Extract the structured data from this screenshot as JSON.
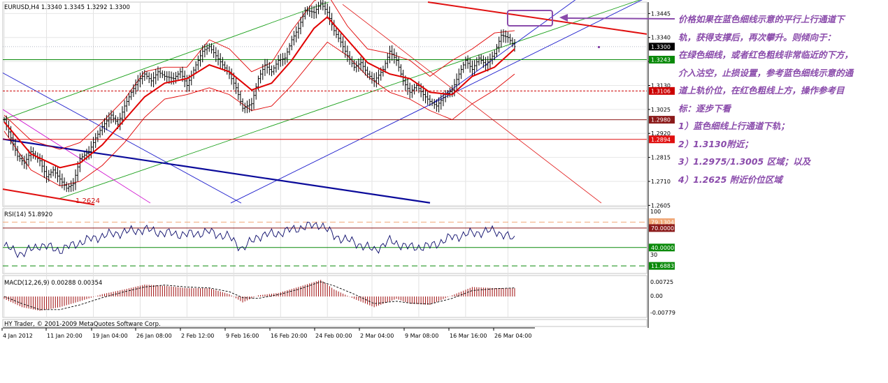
{
  "chart_data": [
    {
      "type": "candlestick",
      "title": "EURUSD,H4  1.3340 1.3345 1.3292 1.3300",
      "ylim": [
        1.26,
        1.3495
      ],
      "y_ticks": [
        "1.3445",
        "1.3340",
        "1.3235",
        "1.3130",
        "1.3025",
        "1.2920",
        "1.2815",
        "1.2710",
        "1.2605"
      ],
      "price_labels": [
        {
          "value": 1.33,
          "label": "1.3300",
          "color": "#000000"
        },
        {
          "value": 1.3243,
          "label": "1.3243",
          "color": "#0a8a0a"
        },
        {
          "value": 1.3106,
          "label": "1.3106",
          "color": "#cc0000"
        },
        {
          "value": 1.298,
          "label": "1.2980",
          "color": "#8b1a1a"
        },
        {
          "value": 1.2894,
          "label": "1.2894",
          "color": "#e01010"
        }
      ],
      "annotation": "1.2624",
      "x_ticks": [
        "4 Jan 2012",
        "11 Jan 20:00",
        "19 Jan 04:00",
        "26 Jan 08:00",
        "2 Feb 12:00",
        "9 Feb 16:00",
        "16 Feb 20:00",
        "24 Feb 00:00",
        "2 Mar 04:00",
        "9 Mar 08:00",
        "16 Mar 16:00",
        "26 Mar 04:00"
      ],
      "close_path": [
        [
          0,
          1.298
        ],
        [
          3,
          1.29
        ],
        [
          6,
          1.282
        ],
        [
          9,
          1.279
        ],
        [
          12,
          1.284
        ],
        [
          16,
          1.28
        ],
        [
          19,
          1.273
        ],
        [
          22,
          1.276
        ],
        [
          25,
          1.272
        ],
        [
          28,
          1.268
        ],
        [
          31,
          1.27
        ],
        [
          34,
          1.281
        ],
        [
          38,
          1.284
        ],
        [
          41,
          1.29
        ],
        [
          44,
          1.295
        ],
        [
          48,
          1.3
        ],
        [
          51,
          1.296
        ],
        [
          54,
          1.304
        ],
        [
          57,
          1.31
        ],
        [
          60,
          1.315
        ],
        [
          63,
          1.318
        ],
        [
          66,
          1.315
        ],
        [
          69,
          1.319
        ],
        [
          72,
          1.317
        ],
        [
          76,
          1.316
        ],
        [
          79,
          1.319
        ],
        [
          82,
          1.313
        ],
        [
          86,
          1.322
        ],
        [
          89,
          1.328
        ],
        [
          92,
          1.33
        ],
        [
          95,
          1.326
        ],
        [
          98,
          1.322
        ],
        [
          101,
          1.318
        ],
        [
          104,
          1.312
        ],
        [
          107,
          1.303
        ],
        [
          111,
          1.305
        ],
        [
          114,
          1.316
        ],
        [
          117,
          1.322
        ],
        [
          120,
          1.319
        ],
        [
          123,
          1.324
        ],
        [
          126,
          1.325
        ],
        [
          129,
          1.333
        ],
        [
          132,
          1.338
        ],
        [
          135,
          1.346
        ],
        [
          139,
          1.345
        ],
        [
          142,
          1.349
        ],
        [
          145,
          1.345
        ],
        [
          148,
          1.337
        ],
        [
          151,
          1.332
        ],
        [
          154,
          1.326
        ],
        [
          157,
          1.321
        ],
        [
          160,
          1.323
        ],
        [
          163,
          1.318
        ],
        [
          166,
          1.315
        ],
        [
          170,
          1.32
        ],
        [
          173,
          1.328
        ],
        [
          176,
          1.324
        ],
        [
          179,
          1.315
        ],
        [
          182,
          1.31
        ],
        [
          185,
          1.313
        ],
        [
          188,
          1.309
        ],
        [
          191,
          1.306
        ],
        [
          194,
          1.304
        ],
        [
          198,
          1.309
        ],
        [
          201,
          1.311
        ],
        [
          204,
          1.318
        ],
        [
          207,
          1.324
        ],
        [
          210,
          1.32
        ],
        [
          213,
          1.325
        ],
        [
          216,
          1.322
        ],
        [
          220,
          1.327
        ],
        [
          223,
          1.335
        ],
        [
          226,
          1.334
        ],
        [
          229,
          1.33
        ]
      ],
      "moving_average": [
        [
          0,
          1.297
        ],
        [
          12,
          1.283
        ],
        [
          25,
          1.277
        ],
        [
          34,
          1.279
        ],
        [
          44,
          1.287
        ],
        [
          54,
          1.298
        ],
        [
          63,
          1.308
        ],
        [
          72,
          1.314
        ],
        [
          82,
          1.316
        ],
        [
          92,
          1.322
        ],
        [
          101,
          1.319
        ],
        [
          111,
          1.311
        ],
        [
          120,
          1.314
        ],
        [
          129,
          1.324
        ],
        [
          139,
          1.338
        ],
        [
          145,
          1.343
        ],
        [
          154,
          1.333
        ],
        [
          163,
          1.323
        ],
        [
          173,
          1.318
        ],
        [
          182,
          1.316
        ],
        [
          191,
          1.31
        ],
        [
          201,
          1.309
        ],
        [
          210,
          1.317
        ],
        [
          220,
          1.321
        ],
        [
          229,
          1.329
        ]
      ],
      "bollinger_upper": [
        [
          0,
          1.3
        ],
        [
          12,
          1.289
        ],
        [
          25,
          1.285
        ],
        [
          34,
          1.288
        ],
        [
          44,
          1.297
        ],
        [
          54,
          1.307
        ],
        [
          63,
          1.319
        ],
        [
          72,
          1.321
        ],
        [
          82,
          1.321
        ],
        [
          92,
          1.333
        ],
        [
          101,
          1.329
        ],
        [
          111,
          1.319
        ],
        [
          120,
          1.323
        ],
        [
          129,
          1.337
        ],
        [
          139,
          1.35
        ],
        [
          145,
          1.353
        ],
        [
          154,
          1.339
        ],
        [
          163,
          1.329
        ],
        [
          173,
          1.327
        ],
        [
          182,
          1.324
        ],
        [
          191,
          1.317
        ],
        [
          201,
          1.324
        ],
        [
          210,
          1.329
        ],
        [
          220,
          1.336
        ],
        [
          229,
          1.337
        ]
      ],
      "bollinger_lower": [
        [
          0,
          1.293
        ],
        [
          12,
          1.276
        ],
        [
          25,
          1.269
        ],
        [
          34,
          1.271
        ],
        [
          44,
          1.278
        ],
        [
          54,
          1.288
        ],
        [
          63,
          1.299
        ],
        [
          72,
          1.307
        ],
        [
          82,
          1.309
        ],
        [
          92,
          1.312
        ],
        [
          101,
          1.309
        ],
        [
          111,
          1.302
        ],
        [
          120,
          1.304
        ],
        [
          129,
          1.313
        ],
        [
          139,
          1.325
        ],
        [
          145,
          1.332
        ],
        [
          154,
          1.326
        ],
        [
          163,
          1.317
        ],
        [
          173,
          1.31
        ],
        [
          182,
          1.307
        ],
        [
          191,
          1.302
        ],
        [
          201,
          1.298
        ],
        [
          210,
          1.305
        ],
        [
          220,
          1.311
        ],
        [
          229,
          1.318
        ]
      ]
    },
    {
      "type": "line",
      "title": "RSI(14) 51.8920",
      "ylim": [
        0,
        100
      ],
      "y_ticks": [
        "100",
        "30"
      ],
      "levels": [
        {
          "value": 79.1304,
          "label": "79.1304",
          "color": "#f0a878"
        },
        {
          "value": 70,
          "label": "70.0000",
          "color": "#8b1a1a"
        },
        {
          "value": 40,
          "label": "40.0000",
          "color": "#0a8a0a"
        },
        {
          "value": 11.6883,
          "label": "11.6883",
          "color": "#0a8a0a"
        }
      ],
      "values": [
        [
          0,
          42
        ],
        [
          8,
          30
        ],
        [
          16,
          44
        ],
        [
          25,
          36
        ],
        [
          34,
          48
        ],
        [
          44,
          58
        ],
        [
          54,
          64
        ],
        [
          63,
          68
        ],
        [
          72,
          62
        ],
        [
          82,
          60
        ],
        [
          92,
          64
        ],
        [
          101,
          56
        ],
        [
          107,
          38
        ],
        [
          114,
          58
        ],
        [
          123,
          62
        ],
        [
          132,
          70
        ],
        [
          142,
          76
        ],
        [
          148,
          58
        ],
        [
          157,
          48
        ],
        [
          166,
          36
        ],
        [
          173,
          50
        ],
        [
          182,
          40
        ],
        [
          191,
          42
        ],
        [
          201,
          56
        ],
        [
          210,
          62
        ],
        [
          220,
          66
        ],
        [
          229,
          52
        ]
      ]
    },
    {
      "type": "bar",
      "title": "MACD(12,26,9) 0.00288 0.00354",
      "ylim": [
        -0.0088,
        0.0088
      ],
      "y_ticks": [
        "0.00725",
        "0.00",
        "-0.00779"
      ],
      "histogram": [
        [
          0,
          -0.001
        ],
        [
          8,
          -0.0045
        ],
        [
          16,
          -0.006
        ],
        [
          25,
          -0.0045
        ],
        [
          34,
          -0.002
        ],
        [
          44,
          0.001
        ],
        [
          54,
          0.003
        ],
        [
          63,
          0.005
        ],
        [
          72,
          0.0045
        ],
        [
          82,
          0.0035
        ],
        [
          92,
          0.0035
        ],
        [
          101,
          0.001
        ],
        [
          107,
          -0.0025
        ],
        [
          114,
          0.0005
        ],
        [
          123,
          0.0015
        ],
        [
          132,
          0.004
        ],
        [
          142,
          0.007
        ],
        [
          148,
          0.003
        ],
        [
          157,
          -0.001
        ],
        [
          166,
          -0.0045
        ],
        [
          176,
          -0.001
        ],
        [
          182,
          -0.003
        ],
        [
          191,
          -0.0035
        ],
        [
          201,
          0.0005
        ],
        [
          210,
          0.004
        ],
        [
          220,
          0.0035
        ],
        [
          229,
          0.0035
        ]
      ],
      "signal": [
        [
          0,
          0
        ],
        [
          8,
          -0.003
        ],
        [
          16,
          -0.0055
        ],
        [
          25,
          -0.0055
        ],
        [
          34,
          -0.0035
        ],
        [
          44,
          -0.0005
        ],
        [
          54,
          0.002
        ],
        [
          63,
          0.004
        ],
        [
          72,
          0.0048
        ],
        [
          82,
          0.004
        ],
        [
          92,
          0.0036
        ],
        [
          101,
          0.002
        ],
        [
          107,
          -0.0005
        ],
        [
          114,
          -0.0008
        ],
        [
          123,
          0.0008
        ],
        [
          132,
          0.003
        ],
        [
          142,
          0.0062
        ],
        [
          148,
          0.0045
        ],
        [
          157,
          0.001
        ],
        [
          166,
          -0.003
        ],
        [
          176,
          -0.002
        ],
        [
          182,
          -0.0028
        ],
        [
          191,
          -0.0032
        ],
        [
          201,
          -0.0008
        ],
        [
          210,
          0.0025
        ],
        [
          220,
          0.0033
        ],
        [
          229,
          0.0036
        ]
      ]
    }
  ],
  "footer": {
    "text": "HY Trader, © 2001-2009 MetaQuotes Software Corp."
  },
  "note": {
    "lines": [
      "价格如果在蓝色细线示意的平行上行通道下",
      "轨，获得支撑后，再次攀升。则倾向于：",
      "在绿色细线，或者红色粗线非常临近的下方，",
      "介入沽空，止损设置，参考蓝色细线示意的通",
      "道上轨价位，在红色粗线上方，操作参考目",
      "标：逐步下看",
      "1）蓝色细线上行通道下轨；",
      "2）1.3130附近；",
      "3）1.2975/1.3005 区域；以及",
      "4）1.2625 附近价位区域"
    ]
  },
  "colors": {
    "price": "#000000",
    "ma": "#e00000",
    "bands": "#e00000",
    "accent": "#8a4bab",
    "macd": "#a01010"
  }
}
